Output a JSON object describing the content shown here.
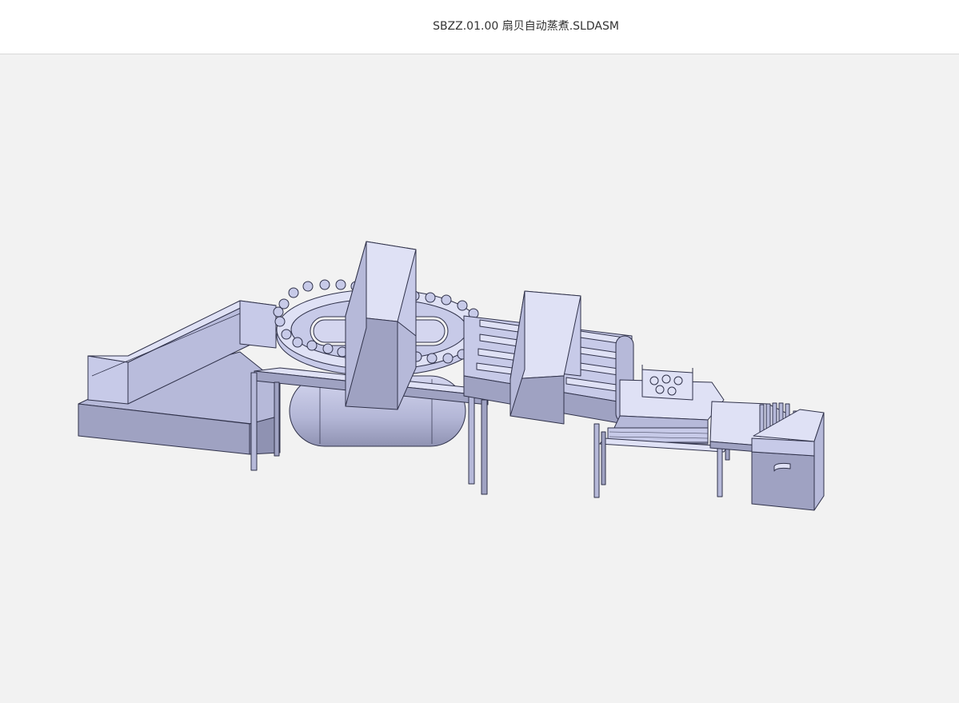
{
  "window": {
    "title": "SBZZ.01.00 扇贝自动蒸煮.SLDASM"
  },
  "viewer": {
    "background": "#f2f2f2",
    "model_fill": "#c7cae8",
    "model_shade": "#9fa2c2",
    "model_dark": "#7f819e",
    "model_edge": "#30324a"
  }
}
